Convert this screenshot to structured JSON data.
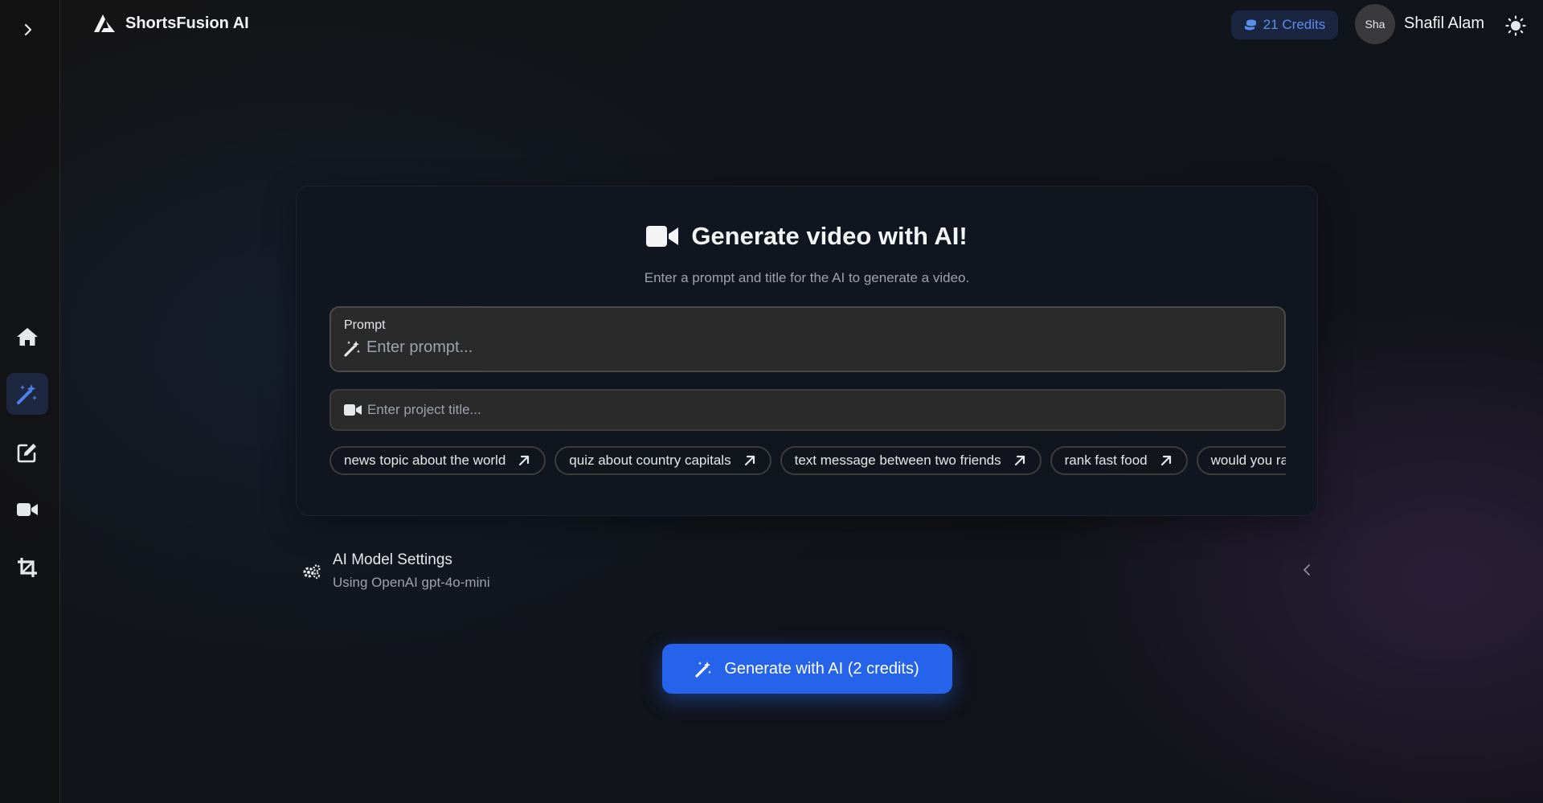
{
  "app": {
    "name": "ShortsFusion AI"
  },
  "header": {
    "credits_label": "21 Credits",
    "avatar_initials": "Sha",
    "user_name": "Shafil Alam"
  },
  "sidebar": {
    "items": [
      {
        "name": "home",
        "icon": "home-icon",
        "active": false
      },
      {
        "name": "ai-generate",
        "icon": "magic-wand-icon",
        "active": true
      },
      {
        "name": "editor",
        "icon": "edit-icon",
        "active": false
      },
      {
        "name": "videos",
        "icon": "video-camera-icon",
        "active": false
      },
      {
        "name": "crop",
        "icon": "crop-icon",
        "active": false
      }
    ]
  },
  "card": {
    "title": "Generate video with AI!",
    "subtitle": "Enter a prompt and title for the AI to generate a video.",
    "prompt": {
      "label": "Prompt",
      "placeholder": "Enter prompt...",
      "value": ""
    },
    "project_title": {
      "placeholder": "Enter project title...",
      "value": ""
    },
    "suggestions": [
      "news topic about the world",
      "quiz about country capitals",
      "text message between two friends",
      "rank fast food",
      "would you rather"
    ]
  },
  "settings": {
    "title": "AI Model Settings",
    "subtitle": "Using OpenAI gpt-4o-mini"
  },
  "generate_button": {
    "label": "Generate with AI (2 credits)"
  },
  "colors": {
    "accent": "#2563eb",
    "credits_text": "#5b8def",
    "active_nav_bg": "#1d2840",
    "background": "#121212"
  }
}
